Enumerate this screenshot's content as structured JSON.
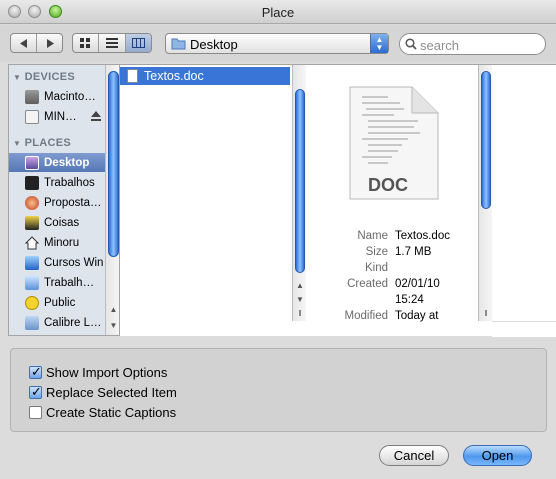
{
  "window": {
    "title": "Place"
  },
  "toolbar": {
    "location": "Desktop",
    "search_placeholder": "search"
  },
  "sidebar": {
    "devices_header": "DEVICES",
    "devices": [
      {
        "label": "Macinto…",
        "icon": "hard-drive-icon"
      },
      {
        "label": "MIN…",
        "icon": "removable-drive-icon"
      }
    ],
    "places_header": "PLACES",
    "places": [
      {
        "label": "Desktop",
        "icon": "desktop-folder-icon",
        "selected": true
      },
      {
        "label": "Trabalhos",
        "icon": "folder-icon"
      },
      {
        "label": "Proposta…",
        "icon": "proposal-icon"
      },
      {
        "label": "Coisas",
        "icon": "folder-icon"
      },
      {
        "label": "Minoru",
        "icon": "home-icon"
      },
      {
        "label": "Cursos Win",
        "icon": "folder-icon"
      },
      {
        "label": "Trabalh…",
        "icon": "folder-icon"
      },
      {
        "label": "Public",
        "icon": "public-icon"
      },
      {
        "label": "Calibre L…",
        "icon": "folder-icon"
      }
    ]
  },
  "file_list": [
    {
      "name": "Textos.doc",
      "selected": true
    }
  ],
  "preview": {
    "badge": "DOC",
    "fields": [
      {
        "key": "Name",
        "value": "Textos.doc"
      },
      {
        "key": "Size",
        "value": "1.7 MB"
      },
      {
        "key": "Kind",
        "value": ""
      },
      {
        "key": "Created",
        "value": "02/01/10"
      },
      {
        "key": "",
        "value": "15:24"
      },
      {
        "key": "Modified",
        "value": "Today at"
      }
    ]
  },
  "options": [
    {
      "label": "Show Import Options",
      "checked": true
    },
    {
      "label": "Replace Selected Item",
      "checked": true
    },
    {
      "label": "Create Static Captions",
      "checked": false
    }
  ],
  "buttons": {
    "cancel": "Cancel",
    "open": "Open"
  }
}
